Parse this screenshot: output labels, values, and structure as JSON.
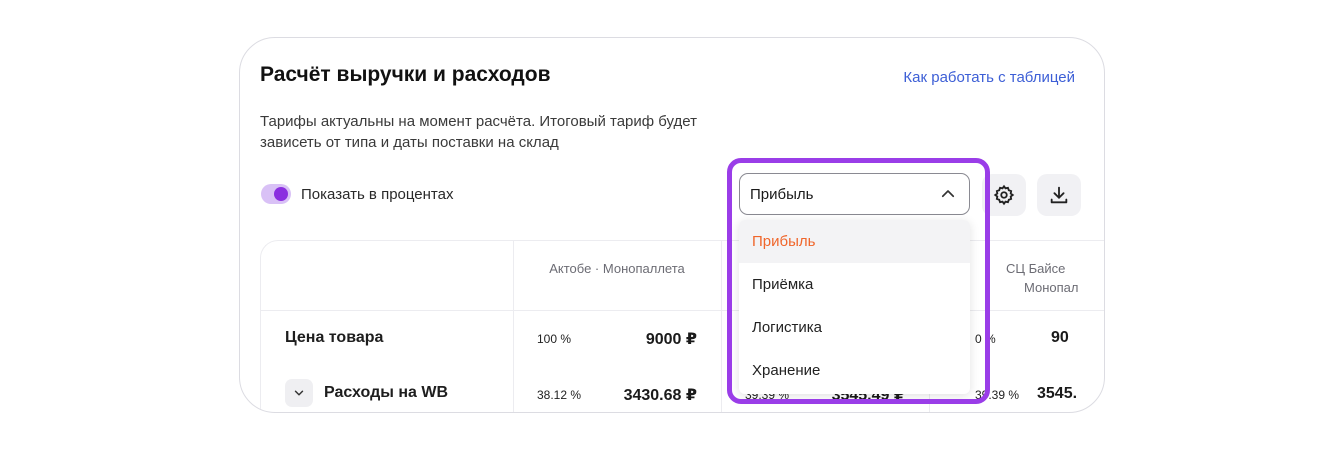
{
  "card": {
    "title": "Расчёт выручки и расходов",
    "help_link": "Как работать с таблицей",
    "description": "Тарифы актуальны на момент расчёта. Итоговый тариф будет зависеть от типа и даты поставки на склад",
    "toggle_label": "Показать в процентах",
    "toggle_on": true
  },
  "select": {
    "value": "Прибыль",
    "options": [
      "Прибыль",
      "Приёмка",
      "Логистика",
      "Хранение"
    ],
    "selected_index": 0
  },
  "table": {
    "columns": [
      {
        "head": "Актобе · Монопаллета"
      },
      {
        "head": ""
      },
      {
        "head_line1": "СЦ Байсе",
        "head_line2": "Монопал"
      }
    ],
    "rows": [
      {
        "label": "Цена товара",
        "cells": [
          {
            "pct": "100 %",
            "value": "9000 ₽"
          },
          {
            "pct": "",
            "value": ""
          },
          {
            "pct": "0 %",
            "value": "90"
          }
        ]
      },
      {
        "label": "Расходы на WB",
        "cells": [
          {
            "pct": "38.12 %",
            "value": "3430.68 ₽"
          },
          {
            "pct": "39.39 %",
            "value": "3545.49 ₽"
          },
          {
            "pct": "39.39 %",
            "value": "3545."
          }
        ]
      }
    ]
  },
  "colors": {
    "accent_purple": "#9a3de8",
    "link_blue": "#3d5fd6",
    "active_option_orange": "#f0662b"
  }
}
